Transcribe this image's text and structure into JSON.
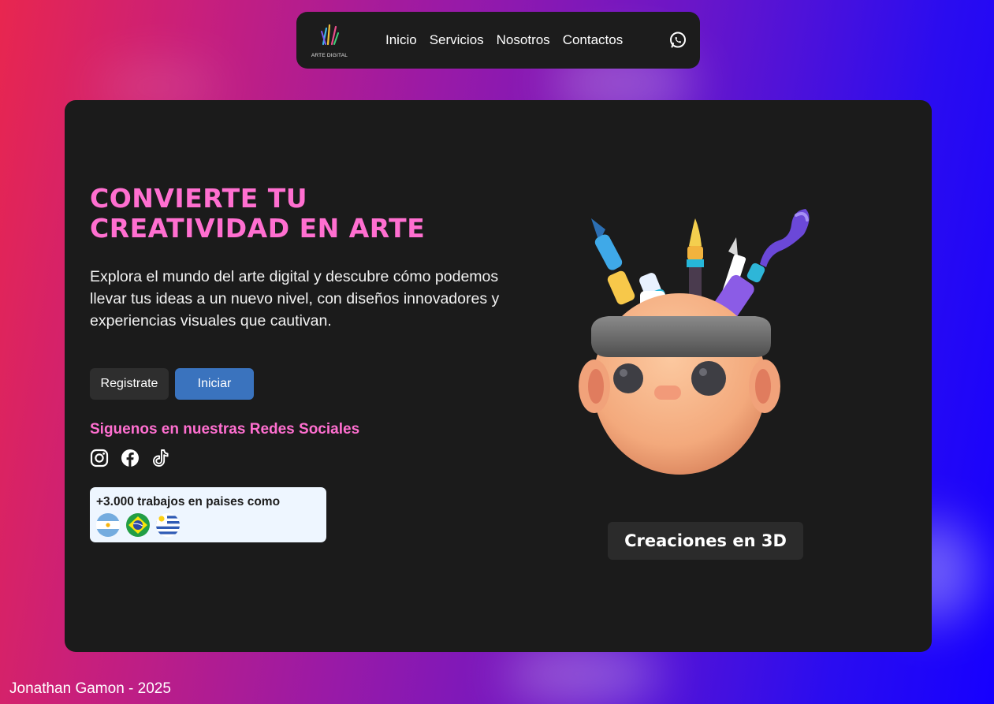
{
  "nav": {
    "logo_text": "ARTE DIGITAL",
    "links": [
      "Inicio",
      "Servicios",
      "Nosotros",
      "Contactos"
    ],
    "whatsapp_icon": "whatsapp-icon"
  },
  "hero": {
    "title": "CONVIERTE TU CREATIVIDAD EN ARTE",
    "description": "Explora el mundo del arte digital y descubre cómo podemos llevar tus ideas a un nuevo nivel, con diseños innovadores y experiencias visuales que cautivan.",
    "register_label": "Registrate",
    "start_label": "Iniciar",
    "social_title": "Siguenos en nuestras Redes Sociales",
    "social_icons": [
      "instagram-icon",
      "facebook-icon",
      "tiktok-icon"
    ],
    "works_text": "+3.000 trabajos en paises como",
    "flags": [
      "argentina-flag",
      "brazil-flag",
      "uruguay-flag"
    ],
    "caption": "Creaciones en 3D"
  },
  "footer": {
    "text": "Jonathan Gamon - 2025"
  },
  "colors": {
    "accent_pink": "#ff6fd0",
    "button_blue": "#3a73be",
    "card_bg": "#1b1b1b"
  }
}
